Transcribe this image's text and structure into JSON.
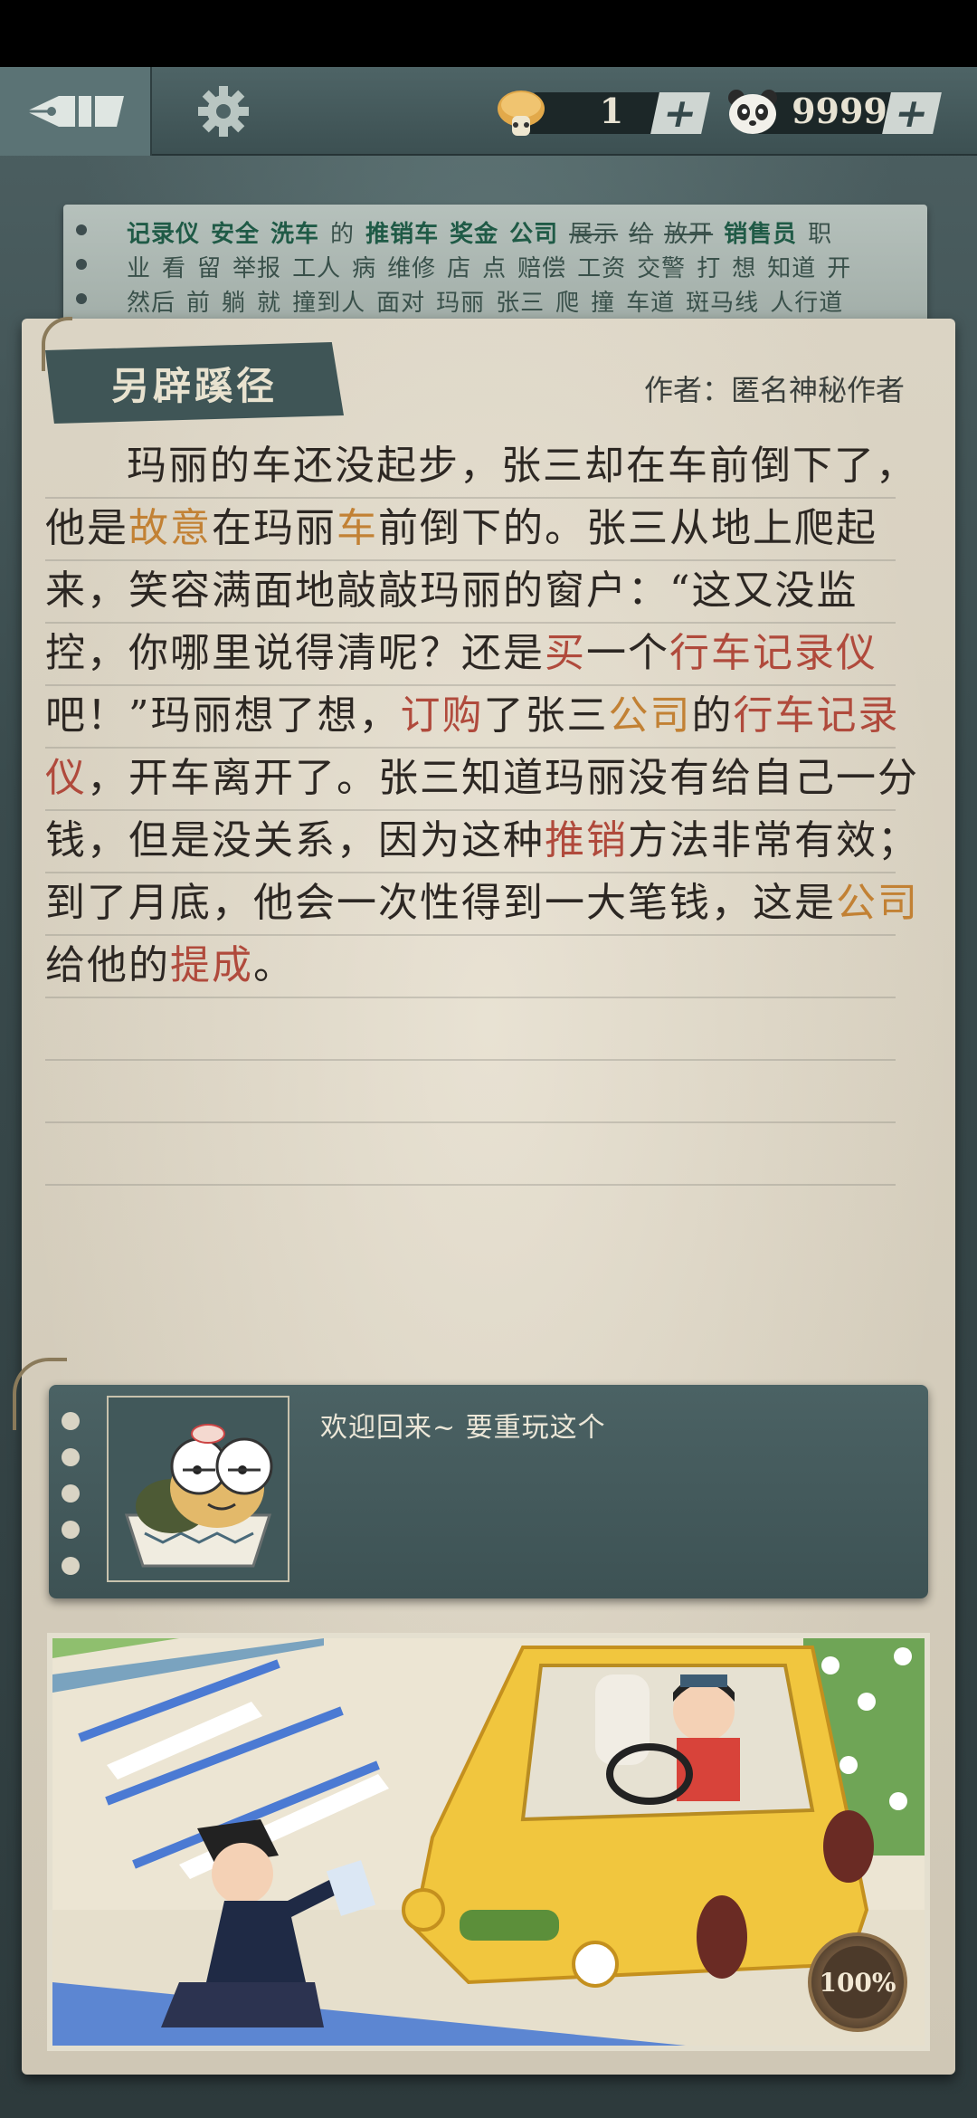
{
  "topbar": {
    "back_icon": "pen-nib-icon",
    "settings_icon": "gear-icon",
    "currency1": {
      "icon": "mushroom-icon",
      "value": "1",
      "plus": "+"
    },
    "currency2": {
      "icon": "panda-icon",
      "value": "9999",
      "plus": "+"
    }
  },
  "word_list": {
    "lines": [
      [
        "记录仪",
        "安全",
        "洗车",
        "的",
        "推销车",
        "奖金",
        "公司",
        "展示",
        "给",
        "放开",
        "销售员",
        "职"
      ],
      [
        "业",
        "看",
        "留",
        "举报",
        "工人",
        "病",
        "维修",
        "店",
        "点",
        "赔偿",
        "工资",
        "交警",
        "打",
        "想",
        "知道",
        "开"
      ],
      [
        "然后",
        "前",
        "躺",
        "就",
        "撞到人",
        "面对",
        "玛丽",
        "张三",
        "爬",
        "撞",
        "车道",
        "斑马线",
        "人行道"
      ]
    ]
  },
  "story": {
    "title": "另辟蹊径",
    "author": "作者：匿名神秘作者",
    "lines": [
      {
        "indent": true,
        "segs": [
          [
            "玛丽的车还没起步，张三却在车前倒下了，",
            ""
          ]
        ]
      },
      {
        "indent": false,
        "segs": [
          [
            "他是",
            ""
          ],
          [
            "故意",
            "a"
          ],
          [
            "在玛丽",
            ""
          ],
          [
            "车",
            "a"
          ],
          [
            "前倒下的。张三从地上爬起",
            ""
          ]
        ]
      },
      {
        "indent": false,
        "segs": [
          [
            "来，笑容满面地敲敲玛丽的窗户：“这又没监",
            ""
          ]
        ]
      },
      {
        "indent": false,
        "segs": [
          [
            "控，你哪里说得清呢？还是",
            ""
          ],
          [
            "买",
            "r"
          ],
          [
            "一个",
            ""
          ],
          [
            "行车记录仪",
            "r"
          ]
        ]
      },
      {
        "indent": false,
        "segs": [
          [
            "吧！”玛丽想了想，",
            ""
          ],
          [
            "订购",
            "r"
          ],
          [
            "了张三",
            ""
          ],
          [
            "公司",
            "a"
          ],
          [
            "的",
            ""
          ],
          [
            "行车记录",
            "r"
          ]
        ]
      },
      {
        "indent": false,
        "segs": [
          [
            "仪",
            "r"
          ],
          [
            "，开车离开了。张三知道玛丽没有给自己一分",
            ""
          ]
        ]
      },
      {
        "indent": false,
        "segs": [
          [
            "钱，但是没关系，因为这种",
            ""
          ],
          [
            "推销",
            "r"
          ],
          [
            "方法非常有效；",
            ""
          ]
        ]
      },
      {
        "indent": false,
        "segs": [
          [
            "到了月底，他会一次性得到一大笔钱，这是",
            ""
          ],
          [
            "公司",
            "a"
          ]
        ]
      },
      {
        "indent": false,
        "segs": [
          [
            "给他的",
            ""
          ],
          [
            "提成",
            "r"
          ],
          [
            "。",
            ""
          ]
        ]
      }
    ]
  },
  "dialog": {
    "speech": "欢迎回来~ 要重玩这个",
    "portrait_icon": "turtle-character-icon"
  },
  "scene": {
    "progress": "100%"
  },
  "colors": {
    "accent_orange": "#c28134",
    "accent_red": "#b04a3c"
  }
}
